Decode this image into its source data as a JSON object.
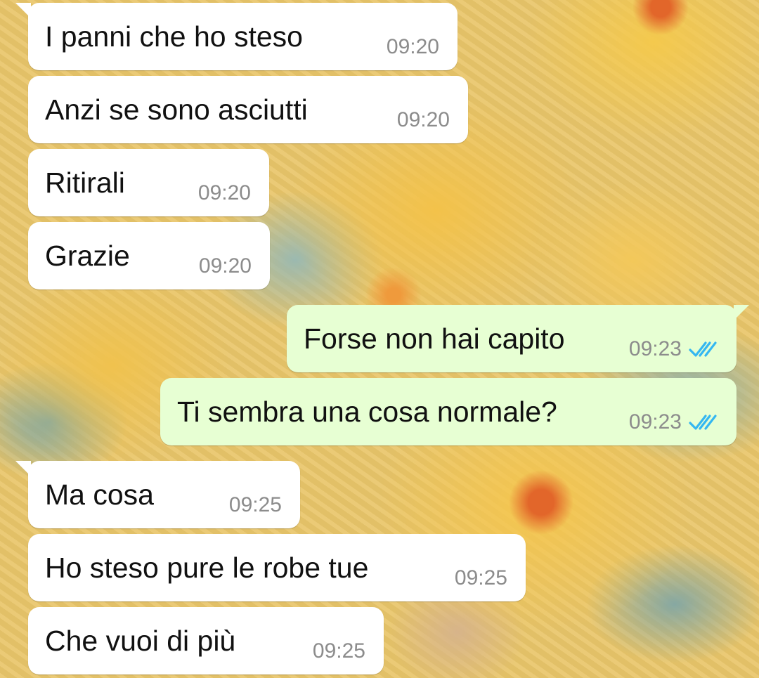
{
  "messages": [
    {
      "direction": "incoming",
      "text": "I panni che ho steso",
      "time": "09:20"
    },
    {
      "direction": "incoming",
      "text": "Anzi se sono asciutti",
      "time": "09:20"
    },
    {
      "direction": "incoming",
      "text": "Ritirali",
      "time": "09:20"
    },
    {
      "direction": "incoming",
      "text": "Grazie",
      "time": "09:20"
    },
    {
      "direction": "outgoing",
      "text": "Forse non hai capito",
      "time": "09:23",
      "status": "read"
    },
    {
      "direction": "outgoing",
      "text": "Ti sembra una cosa normale?",
      "time": "09:23",
      "status": "read"
    },
    {
      "direction": "incoming",
      "text": "Ma cosa",
      "time": "09:25"
    },
    {
      "direction": "incoming",
      "text": "Ho steso pure le robe tue",
      "time": "09:25"
    },
    {
      "direction": "incoming",
      "text": "Che vuoi di più",
      "time": "09:25"
    }
  ],
  "theme": {
    "incoming_bubble": "#ffffff",
    "outgoing_bubble": "#e7ffd3",
    "read_tick_color": "#34b7f1",
    "time_color": "#8c8c8c",
    "wallpaper": "yellow-floral-pattern"
  },
  "icons": {
    "read_receipt": "double-check-icon"
  }
}
